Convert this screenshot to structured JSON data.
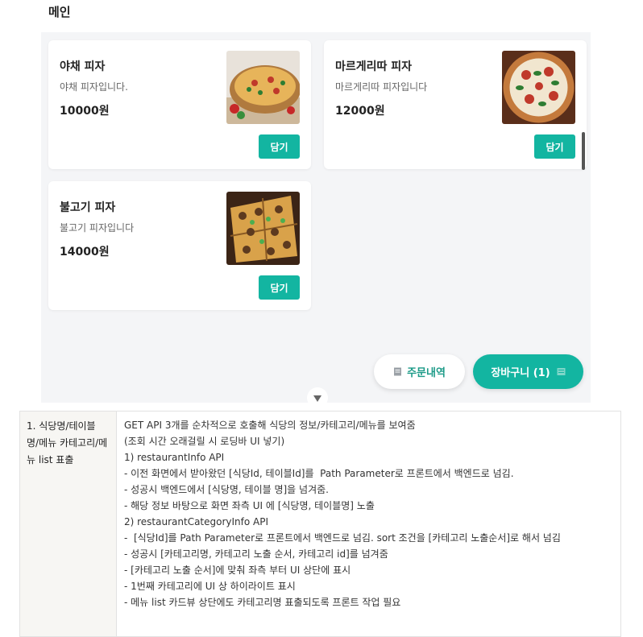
{
  "section": {
    "title": "메인"
  },
  "menu_items": [
    {
      "name": "야채 피자",
      "description": "야채 피자입니다.",
      "price": "10000원",
      "add_label": "담기"
    },
    {
      "name": "마르게리따 피자",
      "description": "마르게리따 피자입니다",
      "price": "12000원",
      "add_label": "담기"
    },
    {
      "name": "불고기 피자",
      "description": "불고기 피자입니다",
      "price": "14000원",
      "add_label": "담기"
    }
  ],
  "floating": {
    "orders_label": "주문내역",
    "cart_label": "장바구니 (1)"
  },
  "colors": {
    "accent": "#13b5a1",
    "panel_bg": "#f4f5f7"
  },
  "spec": {
    "label_number": "1.",
    "label_text": "식당명/테이블 명/메뉴 카테고리/메뉴 list 표출",
    "lines": [
      "GET API 3개를 순차적으로 호출해 식당의 정보/카테고리/메뉴를 보여줌",
      "(조회 시간 오래걸릴 시 로딩바 UI 넣기)",
      "1) restaurantInfo API",
      "- 이전 화면에서 받아왔던 [식당Id, 테이블Id]를  Path Parameter로 프론트에서 백엔드로 넘김.",
      "- 성공시 백엔드에서 [식당명, 테이블 명]을 넘겨줌.",
      "- 해당 정보 바탕으로 화면 좌측 UI 에 [식당명, 테이블명] 노출",
      "2) restaurantCategoryInfo API",
      "-  [식당Id]를 Path Parameter로 프론트에서 백엔드로 넘김. sort 조건을 [카테고리 노출순서]로 해서 넘김",
      "- 성공시 [카테고리명, 카테고리 노출 순서, 카테고리 id]를 넘겨줌",
      "- [카테고리 노출 순서]에 맞춰 좌측 부터 UI 상단에 표시",
      "- 1번째 카테고리에 UI 상 하이라이트 표시",
      "- 메뉴 list 카드뷰 상단에도 카테고리명 표출되도록 프론트 작업 필요"
    ]
  }
}
